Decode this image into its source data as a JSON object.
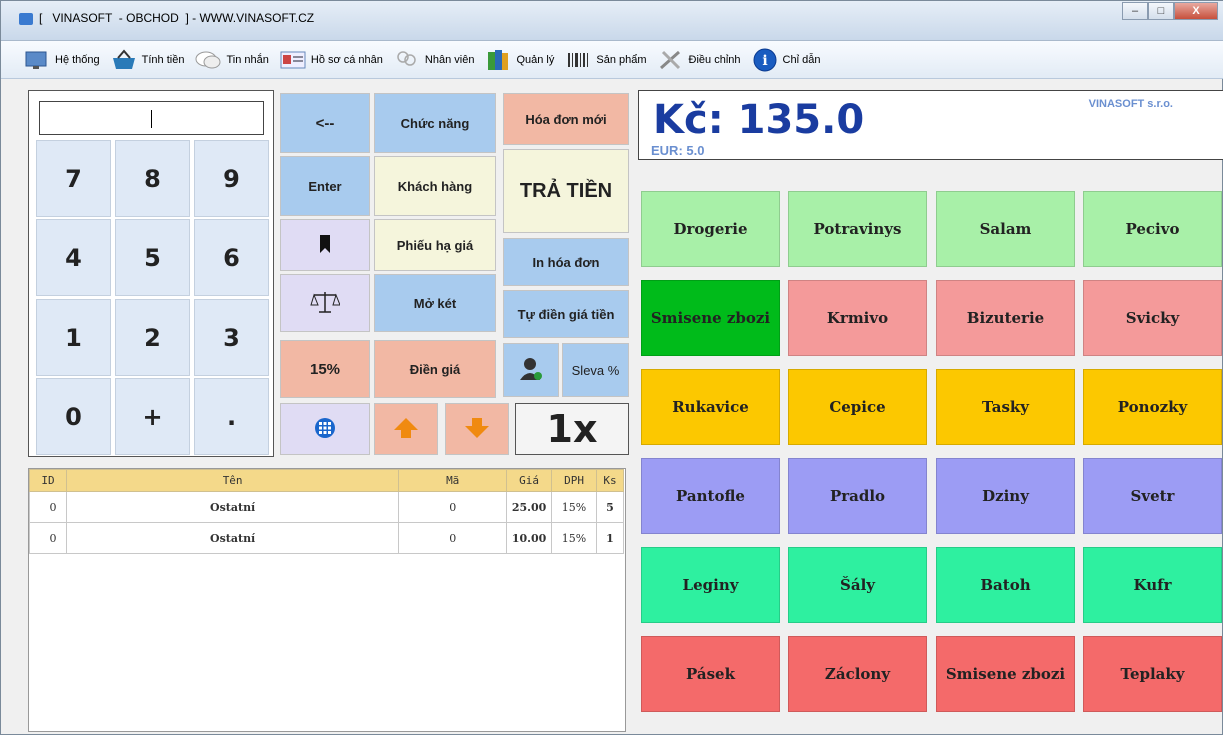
{
  "window": {
    "title": "[   VINASOFT  - OBCHOD  ] - WWW.VINASOFT.CZ",
    "buttons": {
      "minimize": "–",
      "maximize": "□",
      "close": "X"
    }
  },
  "menu": [
    {
      "label": "Hệ thống",
      "icon": "system-icon"
    },
    {
      "label": "Tính tiền",
      "icon": "basket-icon"
    },
    {
      "label": "Tin nhắn",
      "icon": "chat-icon"
    },
    {
      "label": "Hồ sơ cá nhân",
      "icon": "id-card-icon"
    },
    {
      "label": "Nhân viên",
      "icon": "users-icon"
    },
    {
      "label": "Quản lý",
      "icon": "books-icon"
    },
    {
      "label": "Sản phẩm",
      "icon": "barcode-icon"
    },
    {
      "label": "Điều chỉnh",
      "icon": "tools-icon"
    },
    {
      "label": "Chỉ dẫn",
      "icon": "info-icon"
    }
  ],
  "keypad": {
    "display_value": "",
    "keys": [
      "7",
      "8",
      "9",
      "4",
      "5",
      "6",
      "1",
      "2",
      "3",
      "0",
      "+",
      "."
    ]
  },
  "actions": {
    "backspace": "<--",
    "enter": "Enter",
    "function": "Chức năng",
    "customer": "Khách hàng",
    "discount_voucher": "Phiếu hạ giá",
    "open_drawer": "Mở két",
    "fill_price": "Điền giá",
    "pct15": "15%",
    "new_invoice": "Hóa đơn mới",
    "pay": "TRẢ TIỀN",
    "print_invoice": "In hóa đơn",
    "auto_fill_amount": "Tự điền giá tiền",
    "sleva": "Sleva %",
    "multiplier": "1x"
  },
  "table": {
    "headers": [
      "ID",
      "Tên",
      "Mã",
      "Giá",
      "DPH",
      "Ks"
    ],
    "rows": [
      {
        "id": "0",
        "name": "Ostatní",
        "code": "0",
        "price": "25.00",
        "vat": "15%",
        "qty": "5"
      },
      {
        "id": "0",
        "name": "Ostatní",
        "code": "0",
        "price": "10.00",
        "vat": "15%",
        "qty": "1"
      }
    ]
  },
  "total": {
    "main": "Kč: 135.0",
    "eur": "EUR: 5.0",
    "company": "VINASOFT s.r.o."
  },
  "categories": [
    {
      "label": "Drogerie",
      "color": "#a8f0a8"
    },
    {
      "label": "Potravinys",
      "color": "#a8f0a8"
    },
    {
      "label": "Salam",
      "color": "#a8f0a8"
    },
    {
      "label": "Pecivo",
      "color": "#a8f0a8"
    },
    {
      "label": "Smisene zbozi",
      "color": "#00bb1a"
    },
    {
      "label": "Krmivo",
      "color": "#f49a9a"
    },
    {
      "label": "Bizuterie",
      "color": "#f49a9a"
    },
    {
      "label": "Svicky",
      "color": "#f49a9a"
    },
    {
      "label": "Rukavice",
      "color": "#fcc800"
    },
    {
      "label": "Cepice",
      "color": "#fcc800"
    },
    {
      "label": "Tasky",
      "color": "#fcc800"
    },
    {
      "label": "Ponozky",
      "color": "#fcc800"
    },
    {
      "label": "Pantofle",
      "color": "#9c9cf4"
    },
    {
      "label": "Pradlo",
      "color": "#9c9cf4"
    },
    {
      "label": "Dziny",
      "color": "#9c9cf4"
    },
    {
      "label": "Svetr",
      "color": "#9c9cf4"
    },
    {
      "label": "Leginy",
      "color": "#2ef0a0"
    },
    {
      "label": "Šály",
      "color": "#2ef0a0"
    },
    {
      "label": "Batoh",
      "color": "#2ef0a0"
    },
    {
      "label": "Kufr",
      "color": "#2ef0a0"
    },
    {
      "label": "Pásek",
      "color": "#f46a6a"
    },
    {
      "label": "Záclony",
      "color": "#f46a6a"
    },
    {
      "label": "Smisene zbozi",
      "color": "#f46a6a"
    },
    {
      "label": "Teplaky",
      "color": "#f46a6a"
    }
  ]
}
